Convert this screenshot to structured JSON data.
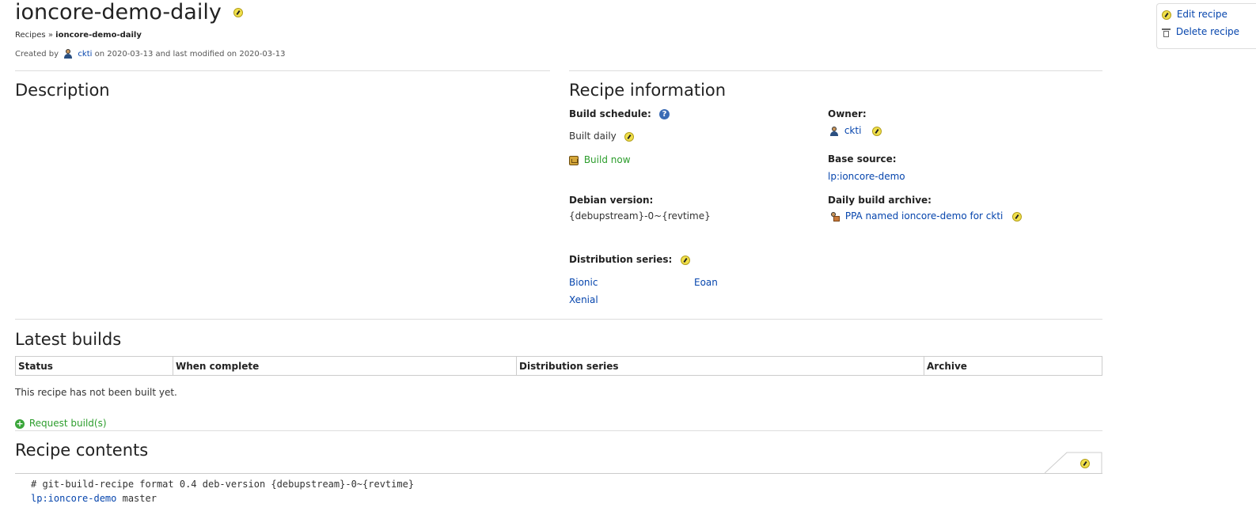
{
  "header": {
    "title": "ioncore-demo-daily",
    "breadcrumb_root": "Recipes",
    "breadcrumb_sep": "»",
    "breadcrumb_current": "ioncore-demo-daily",
    "created_by_prefix": "Created by",
    "created_by_user": "ckti",
    "created_on": "on 2020-03-13 and last modified on 2020-03-13"
  },
  "side_actions": {
    "edit_label": "Edit recipe",
    "delete_label": "Delete recipe"
  },
  "description": {
    "heading": "Description"
  },
  "recipe_info": {
    "heading": "Recipe information",
    "build_schedule_label": "Build schedule:",
    "build_schedule_value": "Built daily",
    "build_now_label": "Build now",
    "debian_version_label": "Debian version:",
    "debian_version_value": "{debupstream}-0~{revtime}",
    "distribution_series_label": "Distribution series:",
    "series": [
      "Bionic",
      "Eoan",
      "Xenial"
    ],
    "owner_label": "Owner:",
    "owner_value": "ckti",
    "base_source_label": "Base source:",
    "base_source_value": "lp:ioncore-demo",
    "daily_archive_label": "Daily build archive:",
    "daily_archive_value": "PPA named ioncore-demo for ckti"
  },
  "latest_builds": {
    "heading": "Latest builds",
    "columns": [
      "Status",
      "When complete",
      "Distribution series",
      "Archive"
    ],
    "empty_message": "This recipe has not been built yet.",
    "request_label": "Request build(s)"
  },
  "recipe_contents": {
    "heading": "Recipe contents",
    "line1": "# git-build-recipe format 0.4 deb-version {debupstream}-0~{revtime}",
    "line2_link": "lp:ioncore-demo",
    "line2_rest": " master"
  },
  "icons": {
    "edit": "edit-icon",
    "help": "help-icon",
    "person": "person-icon",
    "ppa": "ppa-icon",
    "build": "build-icon",
    "add": "add-icon",
    "trash": "trash-icon"
  },
  "colors": {
    "link": "#0645ad",
    "action_green": "#2c9d2c",
    "edit_icon_yellow": "#f1e04a",
    "rule": "#dddddd"
  }
}
